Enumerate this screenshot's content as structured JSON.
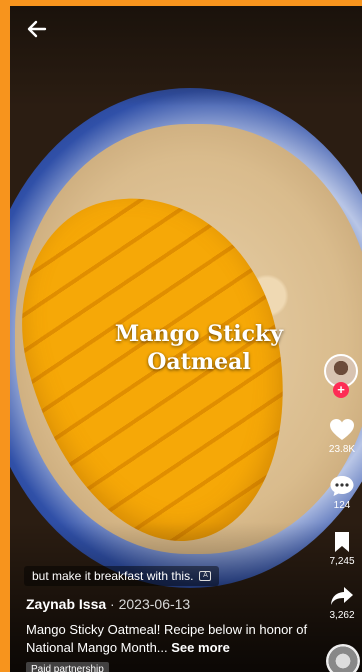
{
  "video": {
    "overlay_title": "Mango Sticky Oatmeal",
    "caption_chip": "but make it breakfast with this."
  },
  "post": {
    "author": "Zaynab Issa",
    "separator": " · ",
    "date": "2023-06-13",
    "description": "Mango Sticky Oatmeal! Recipe below in honor of National Mango Month...",
    "see_more": "See more",
    "paid_tag": "Paid partnership"
  },
  "actions": {
    "follow_symbol": "+",
    "likes": "23.8K",
    "comments": "124",
    "saves": "7,245",
    "shares": "3,262"
  },
  "icons": {
    "back": "arrow-left-icon",
    "like": "heart-icon",
    "comment": "comment-icon",
    "save": "bookmark-icon",
    "share": "share-arrow-icon"
  },
  "colors": {
    "border": "#f7941d",
    "follow": "#fe2c55"
  }
}
